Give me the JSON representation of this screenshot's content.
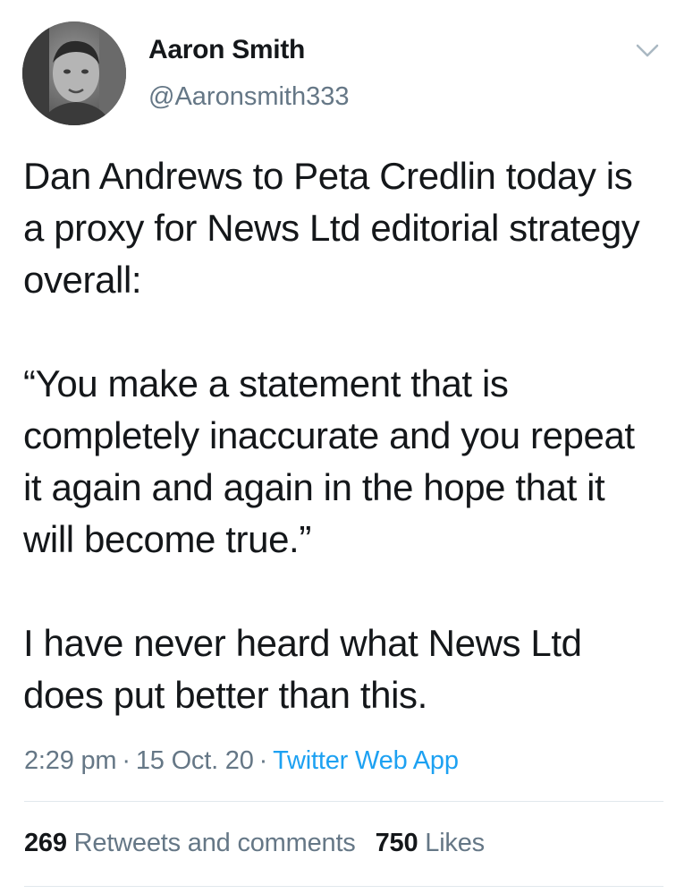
{
  "author": {
    "display_name": "Aaron Smith",
    "handle": "@Aaronsmith333"
  },
  "tweet": {
    "paragraphs": [
      "Dan Andrews to Peta Credlin today is a proxy for News Ltd editorial strategy overall:",
      "“You make a statement that is completely inaccurate and you repeat it again and again in the hope that it will become true.”",
      "I have never heard what News Ltd does put better than this."
    ]
  },
  "meta": {
    "time": "2:29 pm",
    "separator": "·",
    "date": "15 Oct. 20",
    "source": "Twitter Web App"
  },
  "stats": {
    "retweets_count": "269",
    "retweets_label": "Retweets and comments",
    "likes_count": "750",
    "likes_label": "Likes"
  },
  "icons": {
    "caret": "chevron-down-icon"
  },
  "colors": {
    "text_primary": "#14171a",
    "text_secondary": "#657786",
    "link": "#1da1f2",
    "divider": "#e1e8ed"
  }
}
